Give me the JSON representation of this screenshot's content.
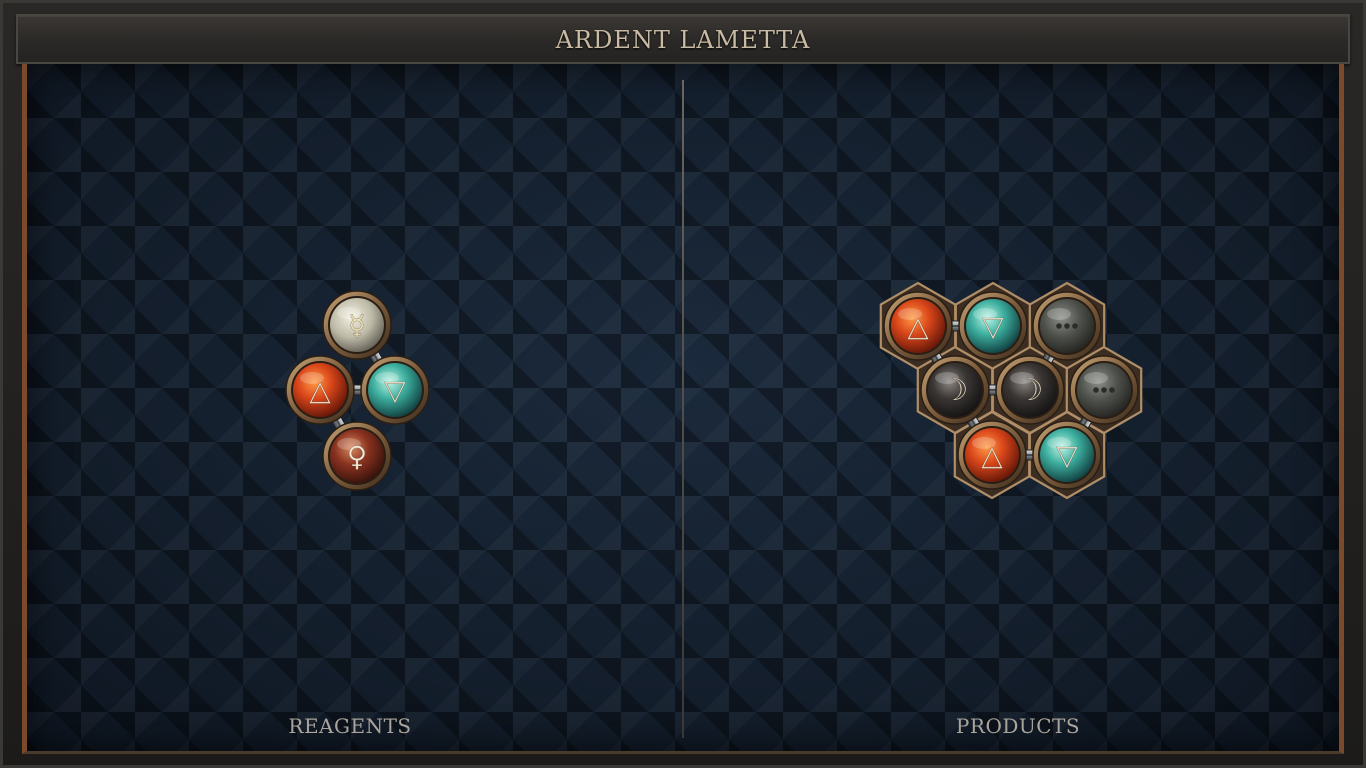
{
  "title": "ARDENT LAMETTA",
  "panels": {
    "reagents_label": "REAGENTS",
    "products_label": "PRODUCTS"
  },
  "colors": {
    "fire": "#c8401c",
    "water": "#3aa79a",
    "quicksilver": "#b9b6a6",
    "venus": "#8a3220",
    "salt": "#2e2b2a",
    "vitae_empty": "#5a5b56",
    "bronze": "#8d6f4e",
    "frame_accent": "#7a4a2a"
  },
  "reagents": {
    "atoms": [
      {
        "id": "r-quicksilver",
        "element": "quicksilver",
        "glyph": "☿",
        "icon": "quicksilver-icon"
      },
      {
        "id": "r-fire",
        "element": "fire",
        "glyph": "△",
        "icon": "fire-icon"
      },
      {
        "id": "r-water",
        "element": "water",
        "glyph": "▽",
        "icon": "water-icon"
      },
      {
        "id": "r-copper",
        "element": "venus",
        "glyph": "♀",
        "icon": "copper-icon"
      }
    ],
    "bonds": [
      [
        "r-quicksilver",
        "r-water"
      ],
      [
        "r-fire",
        "r-water"
      ],
      [
        "r-fire",
        "r-copper"
      ]
    ]
  },
  "products": {
    "atoms": [
      {
        "id": "p-fire-1",
        "element": "fire",
        "glyph": "△",
        "icon": "fire-icon"
      },
      {
        "id": "p-water-1",
        "element": "water",
        "glyph": "▽",
        "icon": "water-icon"
      },
      {
        "id": "p-vitae-1",
        "element": "vitae_empty",
        "glyph": "•••",
        "icon": "ellipsis-icon"
      },
      {
        "id": "p-moon-1",
        "element": "salt",
        "glyph": "☽",
        "icon": "moon-icon"
      },
      {
        "id": "p-moon-2",
        "element": "salt",
        "glyph": "☽",
        "icon": "moon-icon"
      },
      {
        "id": "p-vitae-2",
        "element": "vitae_empty",
        "glyph": "•••",
        "icon": "ellipsis-icon"
      },
      {
        "id": "p-fire-2",
        "element": "fire",
        "glyph": "△",
        "icon": "fire-icon"
      },
      {
        "id": "p-water-2",
        "element": "water",
        "glyph": "▽",
        "icon": "water-icon"
      }
    ],
    "bonds": [
      [
        "p-fire-1",
        "p-water-1"
      ],
      [
        "p-fire-1",
        "p-moon-1"
      ],
      [
        "p-moon-1",
        "p-moon-2"
      ],
      [
        "p-vitae-1",
        "p-moon-2"
      ],
      [
        "p-moon-1",
        "p-fire-2"
      ],
      [
        "p-fire-2",
        "p-water-2"
      ],
      [
        "p-vitae-2",
        "p-water-2"
      ]
    ]
  }
}
